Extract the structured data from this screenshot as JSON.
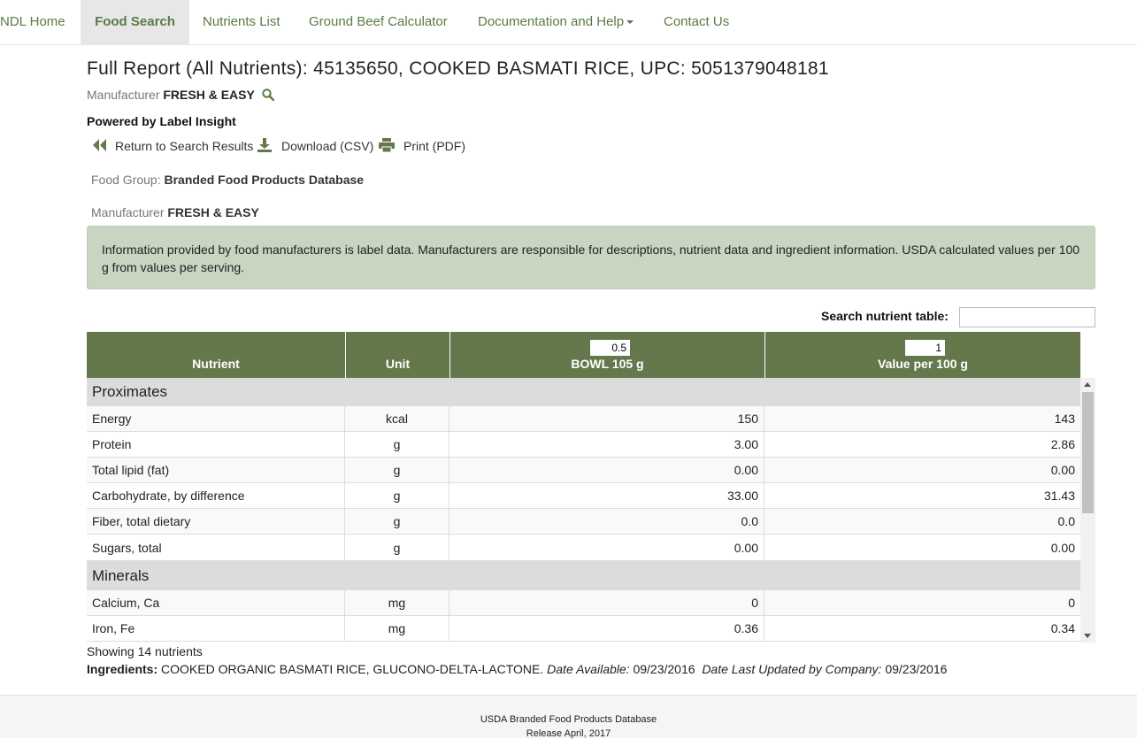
{
  "nav": {
    "items": [
      {
        "label": "NDL Home"
      },
      {
        "label": "Food Search"
      },
      {
        "label": "Nutrients List"
      },
      {
        "label": "Ground Beef Calculator"
      },
      {
        "label": "Documentation and Help"
      },
      {
        "label": "Contact Us"
      }
    ],
    "active_label": "Food Search"
  },
  "report": {
    "title": "Full Report (All Nutrients):  45135650, COOKED BASMATI RICE, UPC: 5051379048181",
    "manufacturer_label": "Manufacturer",
    "manufacturer": "FRESH & EASY",
    "powered_by": "Powered by Label Insight",
    "actions": {
      "return": "Return to Search Results",
      "download": "Download (CSV)",
      "print": "Print (PDF)"
    },
    "food_group_label": "Food Group:",
    "food_group": "Branded Food Products Database",
    "notice": "Information provided by food manufacturers is label data. Manufacturers are responsible for descriptions, nutrient data and ingredient information. USDA calculated values per 100 g from values per serving."
  },
  "search": {
    "label": "Search nutrient table:",
    "value": ""
  },
  "table": {
    "headers": {
      "nutrient": "Nutrient",
      "unit": "Unit",
      "serving": "BOWL 105 g",
      "serving_qty": "0.5",
      "per100": "Value per 100 g",
      "per100_qty": "1"
    },
    "groups": [
      {
        "name": "Proximates",
        "rows": [
          {
            "nutrient": "Energy",
            "unit": "kcal",
            "serving": "150",
            "per100": "143"
          },
          {
            "nutrient": "Protein",
            "unit": "g",
            "serving": "3.00",
            "per100": "2.86"
          },
          {
            "nutrient": "Total lipid (fat)",
            "unit": "g",
            "serving": "0.00",
            "per100": "0.00"
          },
          {
            "nutrient": "Carbohydrate, by difference",
            "unit": "g",
            "serving": "33.00",
            "per100": "31.43"
          },
          {
            "nutrient": "Fiber, total dietary",
            "unit": "g",
            "serving": "0.0",
            "per100": "0.0"
          },
          {
            "nutrient": "Sugars, total",
            "unit": "g",
            "serving": "0.00",
            "per100": "0.00"
          }
        ]
      },
      {
        "name": "Minerals",
        "rows": [
          {
            "nutrient": "Calcium, Ca",
            "unit": "mg",
            "serving": "0",
            "per100": "0"
          },
          {
            "nutrient": "Iron, Fe",
            "unit": "mg",
            "serving": "0.36",
            "per100": "0.34"
          }
        ]
      }
    ],
    "showing": "Showing 14 nutrients"
  },
  "ingredients": {
    "label": "Ingredients:",
    "text": "COOKED ORGANIC BASMATI RICE, GLUCONO-DELTA-LACTONE.",
    "date_available_label": "Date Available:",
    "date_available": "09/23/2016",
    "date_updated_label": "Date Last Updated by Company:",
    "date_updated": "09/23/2016"
  },
  "footer": {
    "line1": "USDA Branded Food Products Database",
    "line2": "Release April, 2017"
  },
  "colors": {
    "nav_link": "#5a7a44",
    "table_header": "#64784c",
    "notice_bg": "#c8d5c1",
    "group_bg": "#dcdcdc"
  }
}
